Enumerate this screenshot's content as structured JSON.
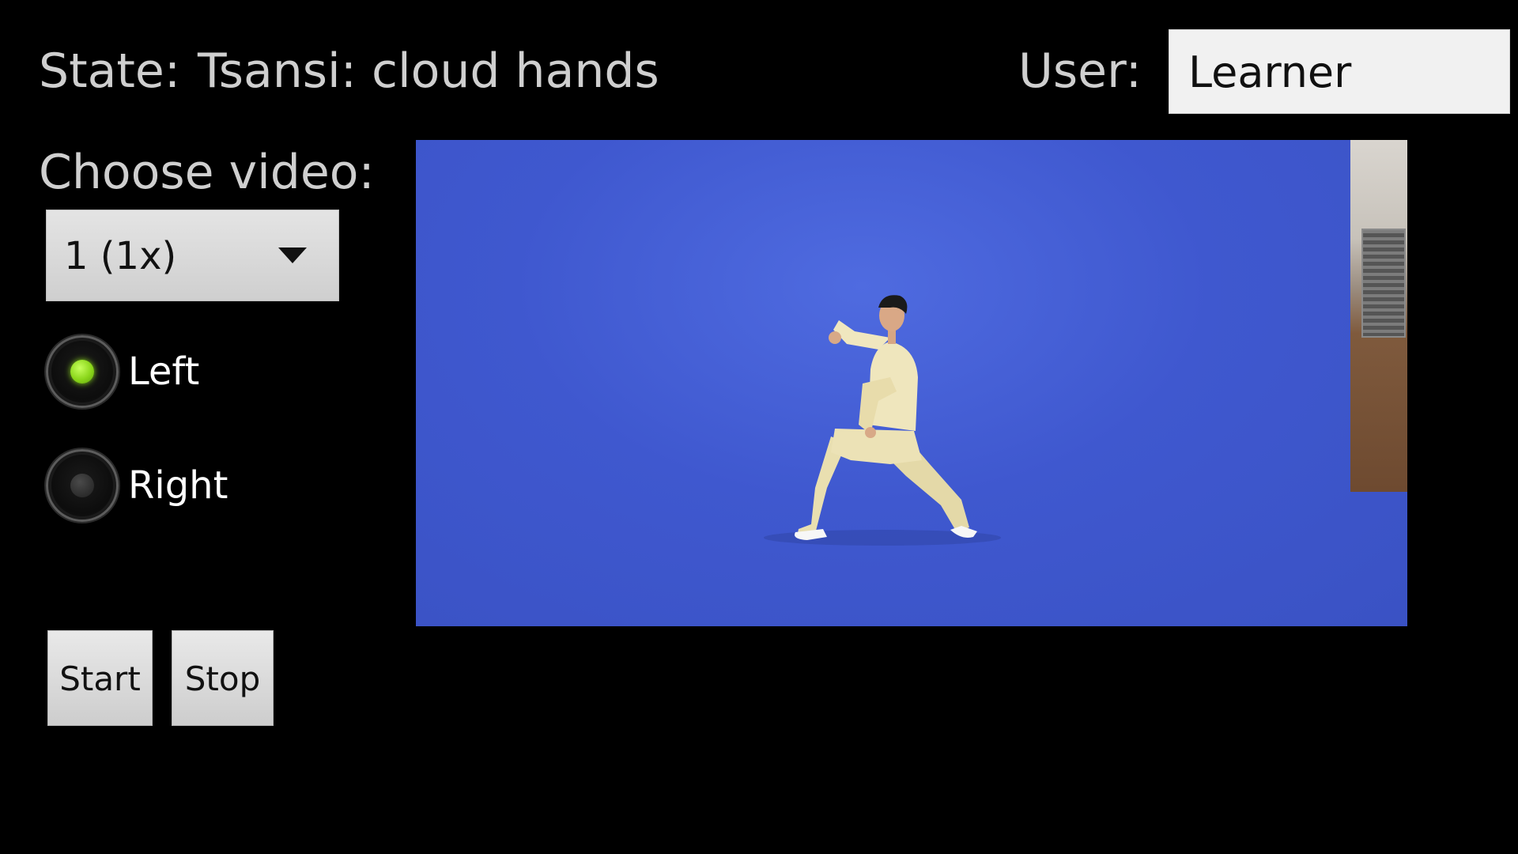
{
  "header": {
    "state_label": "State:",
    "state_value": "Tsansi: cloud hands",
    "user_label": "User:",
    "user_value": "Learner"
  },
  "controls": {
    "choose_label": "Choose video:",
    "video_select_value": "1 (1x)",
    "radios": [
      {
        "label": "Left",
        "checked": true
      },
      {
        "label": "Right",
        "checked": false
      }
    ],
    "start_label": "Start",
    "stop_label": "Stop"
  },
  "video": {
    "content": "tai-chi-demonstrator-on-blue-screen",
    "background_color": "#4059cf"
  },
  "colors": {
    "background": "#000000",
    "label_text": "#cfcfcf",
    "radio_selected": "#8bd61b"
  }
}
